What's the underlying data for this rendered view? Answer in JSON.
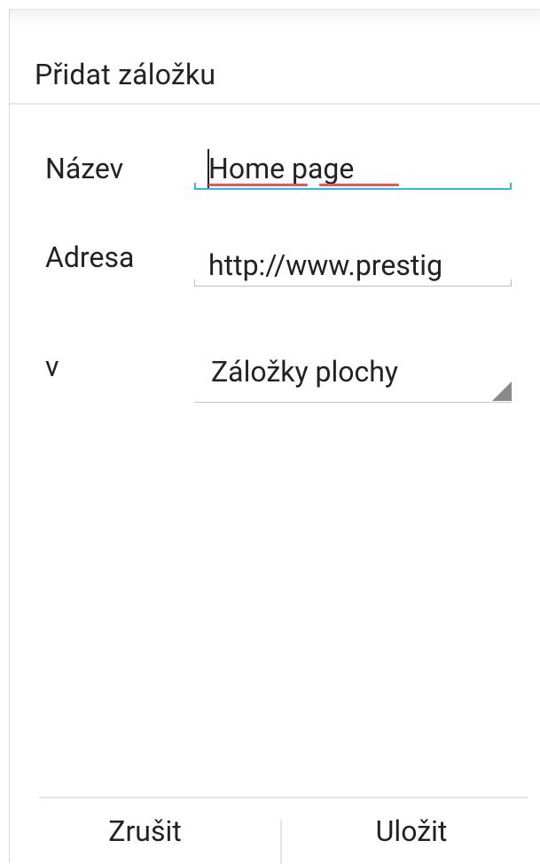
{
  "dialog": {
    "title": "Přidat záložku"
  },
  "form": {
    "name_label": "Název",
    "name_value": "Home page",
    "address_label": "Adresa",
    "address_value": "http://www.prestig",
    "folder_label": "v",
    "folder_value": "Záložky plochy"
  },
  "buttons": {
    "cancel_label": "Zrušit",
    "save_label": "Uložit"
  },
  "colors": {
    "focus_accent": "#33b5e5",
    "spellcheck_underline": "#e05a5a",
    "divider": "#e5e5e5"
  },
  "icons": {
    "spinner_arrow": "triangle-down-right-icon"
  }
}
